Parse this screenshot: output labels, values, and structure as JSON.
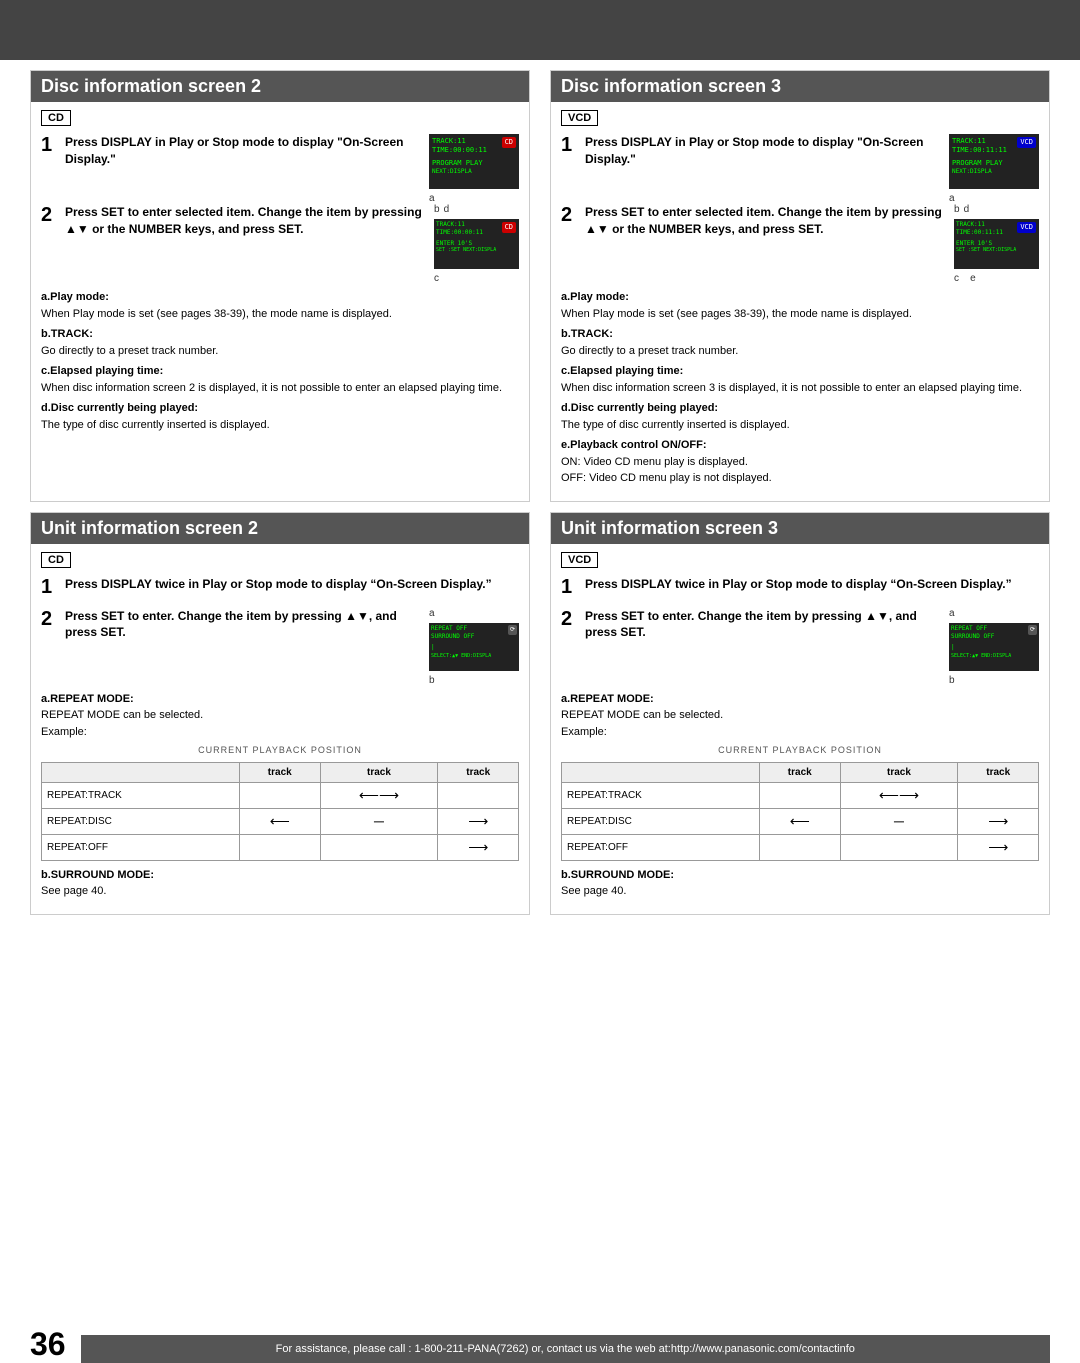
{
  "page": {
    "top_bar_color": "#444",
    "bottom_bar_text": "For assistance, please call : 1-800-211-PANA(7262) or, contact us via the web at:http://www.panasonic.com/contactinfo",
    "page_number": "36"
  },
  "disc_info_2": {
    "title": "Disc information screen 2",
    "badge": "CD",
    "step1_num": "1",
    "step1_text": "Press DISPLAY in Play or Stop mode to display “On-Screen Display.”",
    "step2_num": "2",
    "step2_text": "Press SET to enter selected item. Change the item by pressing ▲▼ or the NUMBER keys, and press SET.",
    "note_a_title": "a.Play mode:",
    "note_a_text": "When Play mode is set (see pages 38-39), the mode name is displayed.",
    "note_b_title": "b.TRACK:",
    "note_b_text": "Go directly to a preset track number.",
    "note_c_title": "c.Elapsed playing time:",
    "note_c_text": "When disc information screen 2 is displayed, it is not possible to enter an elapsed playing time.",
    "note_d_title": "d.Disc currently being played:",
    "note_d_text": "The type of disc currently inserted is displayed."
  },
  "disc_info_3": {
    "title": "Disc information screen 3",
    "badge": "VCD",
    "step1_num": "1",
    "step1_text": "Press DISPLAY in Play or Stop mode to display “On-Screen Display.”",
    "step2_num": "2",
    "step2_text": "Press SET to enter selected item. Change the item by pressing ▲▼ or the NUMBER keys, and press SET.",
    "note_a_title": "a.Play mode:",
    "note_a_text": "When Play mode is set (see pages 38-39), the mode name is displayed.",
    "note_b_title": "b.TRACK:",
    "note_b_text": "Go directly to a preset track number.",
    "note_c_title": "c.Elapsed playing time:",
    "note_c_text": "When disc information screen 3 is displayed, it is not possible to enter an elapsed playing time.",
    "note_d_title": "d.Disc currently being played:",
    "note_d_text": "The type of disc currently inserted is displayed.",
    "note_e_title": "e.Playback control ON/OFF:",
    "note_e_on": "ON:    Video CD menu play is displayed.",
    "note_e_off": "OFF:   Video CD menu play is not displayed."
  },
  "unit_info_2": {
    "title": "Unit information screen 2",
    "badge": "CD",
    "step1_num": "1",
    "step1_text": "Press DISPLAY twice in Play or Stop mode  to display “On-Screen Display.”",
    "step2_num": "2",
    "step2_text": "Press SET to enter. Change the item by pressing ▲▼, and press SET.",
    "note_a_title": "a.REPEAT MODE:",
    "note_a_text": "REPEAT MODE can be selected.",
    "example_label": "Example:",
    "current_pb_label": "CURRENT PLAYBACK POSITION",
    "col1": "track",
    "col2": "track",
    "col3": "track",
    "row1_label": "REPEAT:TRACK",
    "row2_label": "REPEAT:DISC",
    "row3_label": "REPEAT:OFF",
    "note_b_title": "b.SURROUND MODE:",
    "note_b_text": "See page 40."
  },
  "unit_info_3": {
    "title": "Unit information screen 3",
    "badge": "VCD",
    "step1_num": "1",
    "step1_text": "Press DISPLAY twice in Play or Stop mode  to display “On-Screen Display.”",
    "step2_num": "2",
    "step2_text": "Press SET to enter. Change the item by pressing ▲▼, and press SET.",
    "note_a_title": "a.REPEAT MODE:",
    "note_a_text": "REPEAT MODE can be selected.",
    "example_label": "Example:",
    "current_pb_label": "CURRENT PLAYBACK POSITION",
    "col1": "track",
    "col2": "track",
    "col3": "track",
    "row1_label": "REPEAT:TRACK",
    "row2_label": "REPEAT:DISC",
    "row3_label": "REPEAT:OFF",
    "note_b_title": "b.SURROUND MODE:",
    "note_b_text": "See page 40."
  }
}
